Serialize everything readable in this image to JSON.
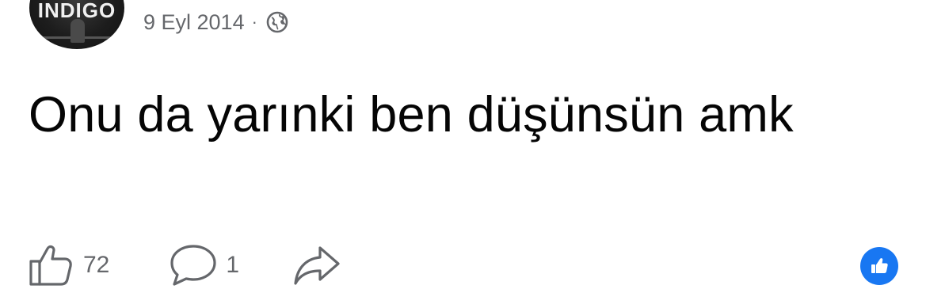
{
  "author": {
    "avatar_text": "INDIGO",
    "avatar_icon": "profile-avatar"
  },
  "meta": {
    "date": "9 Eyl 2014",
    "separator": "·",
    "audience_icon": "globe-icon"
  },
  "post": {
    "text": "Onu da yarınki ben düşünsün amk"
  },
  "actions": {
    "like": {
      "icon": "thumbs-up-outline-icon",
      "count": "72"
    },
    "comment": {
      "icon": "speech-bubble-icon",
      "count": "1"
    },
    "share": {
      "icon": "share-arrow-icon"
    }
  },
  "reaction_badge": {
    "icon": "like-reaction-icon",
    "color": "#1877f2"
  },
  "colors": {
    "text_primary": "#050505",
    "text_secondary": "#65676b",
    "accent": "#1877f2"
  }
}
